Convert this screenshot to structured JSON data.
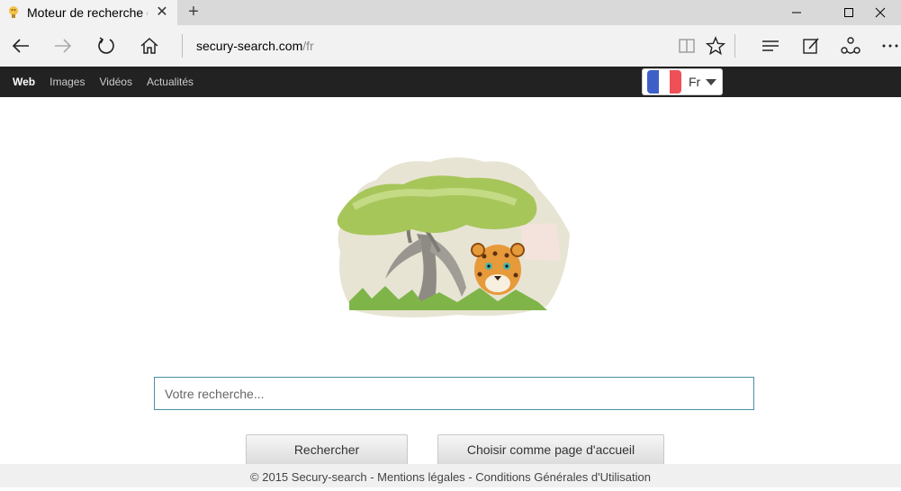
{
  "browser": {
    "tab_title": "Moteur de recherche gr",
    "tab_close": "✕",
    "new_tab": "+",
    "url_host": "secury-search.com",
    "url_path": "/fr"
  },
  "site_nav": {
    "items": [
      "Web",
      "Images",
      "Vidéos",
      "Actualités"
    ]
  },
  "language": {
    "code": "Fr",
    "flag_colors": [
      "#3f5fc8",
      "#ffffff",
      "#ef4f57"
    ]
  },
  "search": {
    "placeholder": "Votre recherche...",
    "value": ""
  },
  "buttons": {
    "search_label": "Rechercher",
    "homepage_label": "Choisir comme page d'accueil"
  },
  "footer": {
    "text": "© 2015 Secury-search - Mentions légales - Conditions Générales d'Utilisation"
  }
}
